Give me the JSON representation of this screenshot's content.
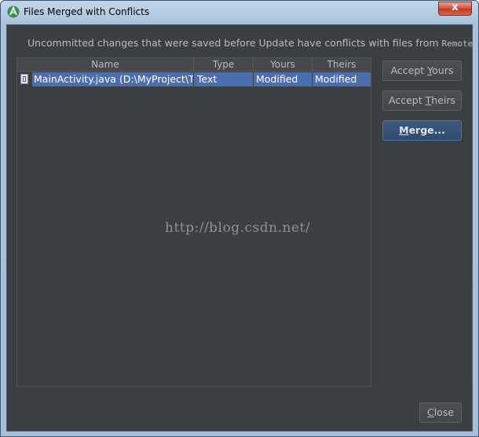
{
  "window": {
    "title": "Files Merged with Conflicts",
    "close_glyph": "x"
  },
  "message": {
    "text": "Uncommitted changes that were saved before Update have conflicts with files from",
    "branch": "Remote"
  },
  "table": {
    "headers": {
      "name": "Name",
      "type": "Type",
      "yours": "Yours",
      "theirs": "Theirs"
    },
    "rows": [
      {
        "name": "MainActivity.java (D:\\MyProject\\Tes",
        "type": "Text",
        "yours": "Modified",
        "theirs": "Modified",
        "icon": "java-file-icon"
      }
    ]
  },
  "buttons": {
    "accept_yours": {
      "before": "Accept ",
      "mnemonic": "Y",
      "after": "ours"
    },
    "accept_theirs": {
      "before": "Accept ",
      "mnemonic": "T",
      "after": "heirs"
    },
    "merge": {
      "before": "",
      "mnemonic": "M",
      "after": "erge..."
    },
    "close": {
      "before": "",
      "mnemonic": "C",
      "after": "lose"
    }
  },
  "watermark": "http://blog.csdn.net/",
  "colors": {
    "background": "#3c3f41",
    "selection": "#4b6eaf",
    "text": "#bbbbbb",
    "default_button": "#365880"
  }
}
